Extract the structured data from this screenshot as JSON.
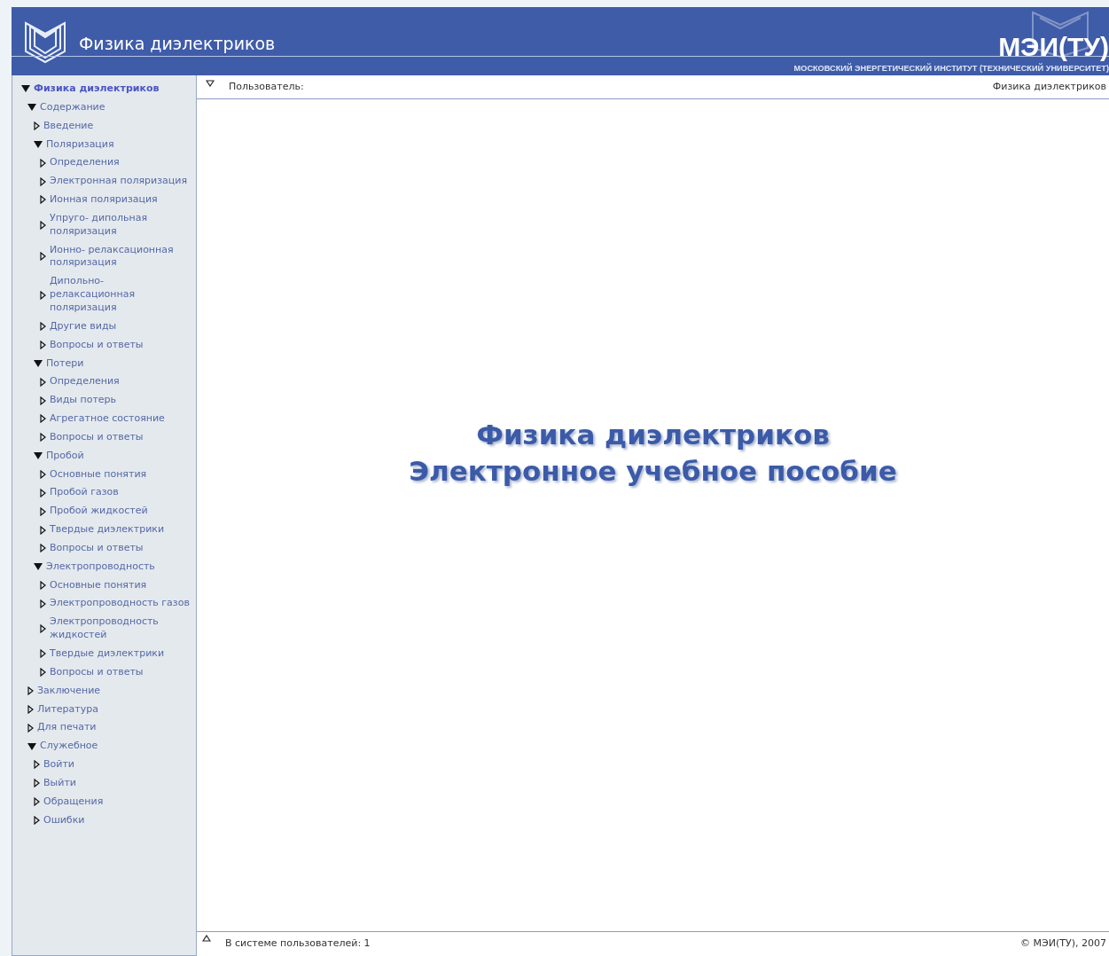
{
  "header": {
    "title": "Физика диэлектриков",
    "logo_text": "МЭИ(ТУ)",
    "institute": "МОСКОВСКИЙ ЭНЕРГЕТИЧЕСКИЙ ИНСТИТУТ (ТЕХНИЧЕСКИЙ УНИВЕРСИТЕТ)"
  },
  "sidebar": {
    "items": [
      {
        "label": "Физика диэлектриков",
        "expanded": true,
        "children": [
          {
            "label": "Содержание",
            "expanded": true,
            "children": [
              {
                "label": "Введение",
                "expanded": false
              },
              {
                "label": "Поляризация",
                "expanded": true,
                "children": [
                  {
                    "label": "Определения",
                    "expanded": false
                  },
                  {
                    "label": "Электронная поляризация",
                    "expanded": false
                  },
                  {
                    "label": "Ионная поляризация",
                    "expanded": false
                  },
                  {
                    "label": "Упруго- дипольная поляризация",
                    "expanded": false
                  },
                  {
                    "label": "Ионно- релаксационная поляризация",
                    "expanded": false
                  },
                  {
                    "label": "Дипольно- релаксационная поляризация",
                    "expanded": false
                  },
                  {
                    "label": "Другие виды",
                    "expanded": false
                  },
                  {
                    "label": "Вопросы и ответы",
                    "expanded": false
                  }
                ]
              },
              {
                "label": "Потери",
                "expanded": true,
                "children": [
                  {
                    "label": "Определения",
                    "expanded": false
                  },
                  {
                    "label": "Виды потерь",
                    "expanded": false
                  },
                  {
                    "label": "Агрегатное состояние",
                    "expanded": false
                  },
                  {
                    "label": "Вопросы и ответы",
                    "expanded": false
                  }
                ]
              },
              {
                "label": "Пробой",
                "expanded": true,
                "children": [
                  {
                    "label": "Основные понятия",
                    "expanded": false
                  },
                  {
                    "label": "Пробой газов",
                    "expanded": false
                  },
                  {
                    "label": "Пробой жидкостей",
                    "expanded": false
                  },
                  {
                    "label": "Твердые диэлектрики",
                    "expanded": false
                  },
                  {
                    "label": "Вопросы и ответы",
                    "expanded": false
                  }
                ]
              },
              {
                "label": "Электропроводность",
                "expanded": true,
                "children": [
                  {
                    "label": "Основные понятия",
                    "expanded": false
                  },
                  {
                    "label": "Электропроводность газов",
                    "expanded": false
                  },
                  {
                    "label": "Электропроводность жидкостей",
                    "expanded": false
                  },
                  {
                    "label": "Твердые диэлектрики",
                    "expanded": false
                  },
                  {
                    "label": "Вопросы и ответы",
                    "expanded": false
                  }
                ]
              }
            ]
          },
          {
            "label": "Заключение",
            "expanded": false
          },
          {
            "label": "Литература",
            "expanded": false
          },
          {
            "label": "Для печати",
            "expanded": false
          },
          {
            "label": "Служебное",
            "expanded": true,
            "children": [
              {
                "label": "Войти",
                "expanded": false
              },
              {
                "label": "Выйти",
                "expanded": false
              },
              {
                "label": "Обращения",
                "expanded": false
              },
              {
                "label": "Ошибки",
                "expanded": false
              }
            ]
          }
        ]
      }
    ]
  },
  "top_bar": {
    "user_label": "Пользователь:",
    "course": "Физика диэлектриков"
  },
  "content": {
    "title_lines": [
      "Физика диэлектриков",
      "Электронное учебное пособие"
    ]
  },
  "status_bar": {
    "users_online": "В системе пользователей: 1",
    "copyright": "© МЭИ(ТУ), 2007"
  }
}
